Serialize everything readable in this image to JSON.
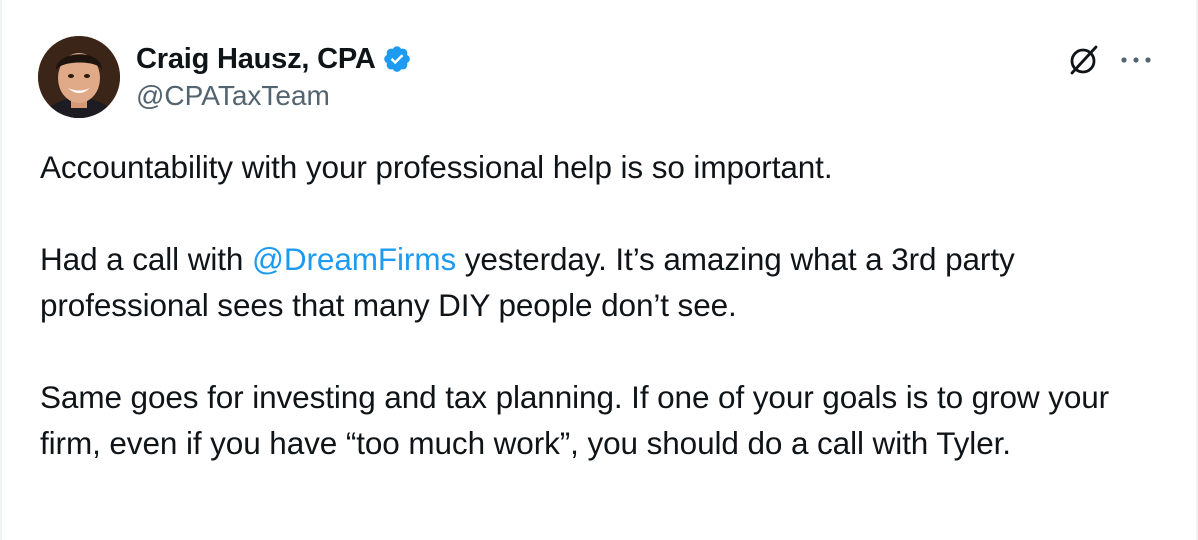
{
  "author": {
    "display_name": "Craig Hausz, CPA",
    "handle": "@CPATaxTeam",
    "verified": true
  },
  "colors": {
    "link": "#1d9bf0",
    "verified_badge": "#1d9bf0",
    "text": "#0f1419",
    "secondary_text": "#536471"
  },
  "icons": {
    "avatar": "profile-photo",
    "verified": "verified-badge-icon",
    "grok": "grok-icon",
    "more": "more-options-icon"
  },
  "tweet": {
    "para1": "Accountability with your professional help is so important.",
    "para2_before": "Had a call with ",
    "para2_mention": "@DreamFirms",
    "para2_after": " yesterday. It’s amazing what a 3rd party professional sees that many DIY people don’t see.",
    "para3": "Same goes for investing and tax planning. If one of your goals is to grow your firm, even if you have “too much work”, you should do a call with Tyler."
  }
}
